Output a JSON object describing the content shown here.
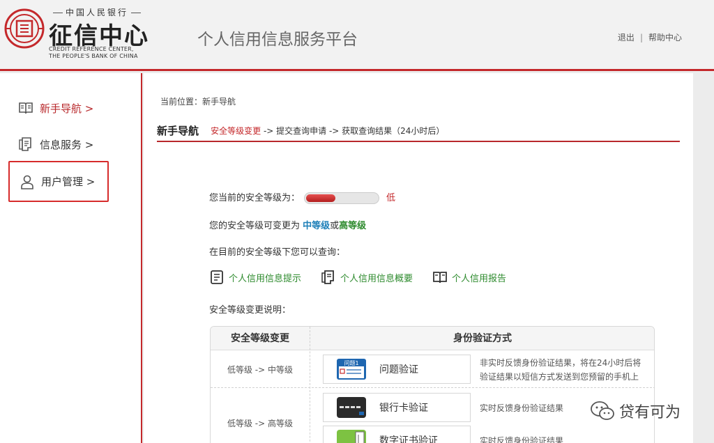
{
  "header": {
    "logo_top": "中国人民银行",
    "logo_name": "征信中心",
    "logo_en_line1": "CREDIT REFERENCE CENTER,",
    "logo_en_line2": "THE PEOPLE'S BANK OF CHINA",
    "platform_title": "个人信用信息服务平台",
    "logout": "退出",
    "separator": "|",
    "help": "帮助中心",
    "brand_color": "#c4282b"
  },
  "sidebar": {
    "items": [
      {
        "label": "新手导航 >",
        "icon": "book-icon"
      },
      {
        "label": "信息服务 >",
        "icon": "document-icon"
      },
      {
        "label": "用户管理 >",
        "icon": "user-icon"
      }
    ]
  },
  "main": {
    "breadcrumb": "当前位置：新手导航",
    "page_title": "新手导航",
    "flow": {
      "step1": "安全等级变更",
      "rest": " -> 提交查询申请 -> 获取查询结果（24小时后）"
    },
    "security": {
      "current_label": "您当前的安全等级为：",
      "level_fraction": 0.4,
      "level_text": "低",
      "change_prefix": "您的安全等级可变更为 ",
      "mid": "中等级",
      "or": "或",
      "high": "高等级",
      "query_label": "在目前的安全等级下您可以查询："
    },
    "links": [
      {
        "label": "个人信用信息提示",
        "icon": "list-doc-icon"
      },
      {
        "label": "个人信用信息概要",
        "icon": "document-icon"
      },
      {
        "label": "个人信用报告",
        "icon": "book-icon"
      }
    ],
    "explain_label": "安全等级变更说明：",
    "table": {
      "headers": [
        "安全等级变更",
        "身份验证方式"
      ],
      "row1_level": "低等级 -> 中等级",
      "row2_level": "低等级 -> 高等级",
      "methods": [
        {
          "label": "问题验证",
          "icon_text": "问题1",
          "desc1": "非实时反馈身份验证结果，将在24小时后将",
          "desc2": "验证结果以短信方式发送到您预留的手机上"
        },
        {
          "label": "银行卡验证",
          "icon_text": "",
          "desc1": "实时反馈身份验证结果",
          "desc2": ""
        },
        {
          "label": "数字证书验证",
          "icon_text": "",
          "desc1": "实时反馈身份验证结果",
          "desc2": ""
        }
      ]
    }
  },
  "watermark": "贷有可为"
}
